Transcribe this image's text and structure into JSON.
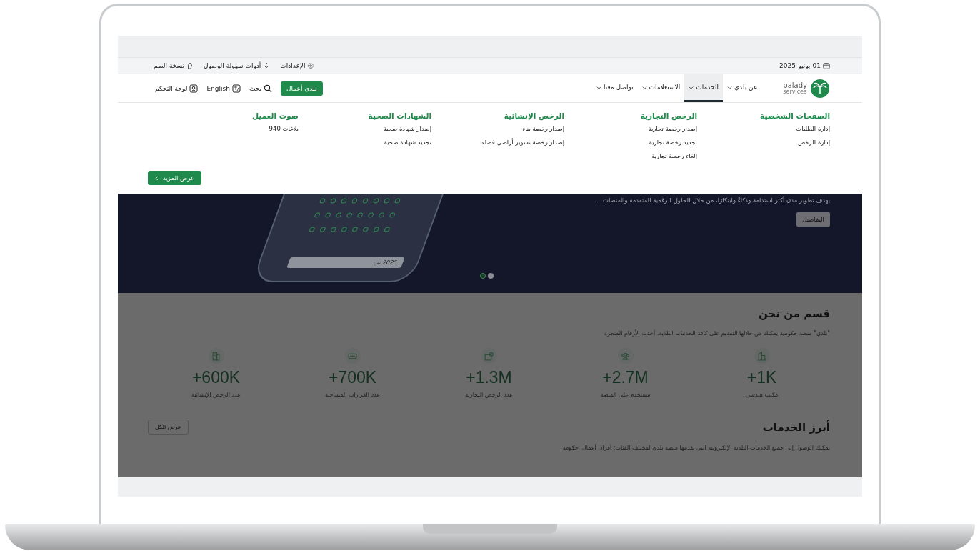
{
  "utility_bar": {
    "date": "01-يونيو-2025",
    "links": [
      {
        "kind": "settings",
        "label": "الإعدادات"
      },
      {
        "kind": "accessibility",
        "label": "أدوات سهولة الوصول"
      },
      {
        "kind": "sign",
        "label": "نسخة الصم"
      }
    ]
  },
  "nav": {
    "logo_text": "balady",
    "logo_sub": "services",
    "items": [
      {
        "label": "عن بلدي",
        "selected": false
      },
      {
        "label": "الخدمات",
        "selected": true
      },
      {
        "label": "الاستعلامات",
        "selected": false
      },
      {
        "label": "تواصل معنا",
        "selected": false
      }
    ],
    "business_button": "بلدي أعمال",
    "actions": [
      {
        "kind": "search",
        "label": "بحث"
      },
      {
        "kind": "language",
        "label": "English"
      },
      {
        "kind": "dashboard",
        "label": "لوحة التحكم"
      }
    ]
  },
  "mega_menu": {
    "columns": [
      {
        "title": "الصفحات الشخصية",
        "items": [
          "إدارة الطلبات",
          "إدارة الرخص"
        ]
      },
      {
        "title": "الرخص التجارية",
        "items": [
          "إصدار رخصة تجارية",
          "تجديد رخصة تجارية",
          "إلغاء رخصة تجارية"
        ]
      },
      {
        "title": "الرخص الإنشائية",
        "items": [
          "إصدار رخصة بناء",
          "إصدار رخصة تسوير أراضي فضاء"
        ]
      },
      {
        "title": "الشهادات الصحية",
        "items": [
          "إصدار شهادة صحية",
          "تجديد شهادة صحية"
        ]
      },
      {
        "title": "صوت العميل",
        "items": [
          "بلاغات 940"
        ]
      }
    ],
    "more_button": "عرض المزيد"
  },
  "hero": {
    "text": "يهدف تطوير مدن أكثر استدامة وذكاءً وابتكارًا، من خلال الحلول الرقمية المتقدمة والمنصات...",
    "details_button": "التفاصيل",
    "phone_search": "2025 تب",
    "slides": [
      {
        "selected": true
      },
      {
        "selected": false
      }
    ]
  },
  "about": {
    "title": "قسم من نحن",
    "description": "\"بلدي\" منصة حكومية يمكنك من خلالها التقديم على كافة الخدمات البلدية، أحدث الأرقام المنجزة",
    "stats": [
      {
        "kind": "office",
        "value": "+1K",
        "label": "مكتب هندسي"
      },
      {
        "kind": "users",
        "value": "+2.7M",
        "label": "مستخدم على المنصة"
      },
      {
        "kind": "commercial",
        "value": "+1.3M",
        "label": "عدد الرخص التجارية"
      },
      {
        "kind": "survey",
        "value": "+700K",
        "label": "عدد القرارات المساحية"
      },
      {
        "kind": "construction",
        "value": "+600K",
        "label": "عدد الرخص الإنشائية"
      }
    ]
  },
  "services": {
    "title": "أبرز الخدمات",
    "view_all": "عرض الكل",
    "description": "يمكنك الوصول إلى جميع الخدمات البلدية الإلكترونية التي تقدمها منصة بلدي لمختلف الفئات: أفراد، أعمال، حكومة"
  }
}
